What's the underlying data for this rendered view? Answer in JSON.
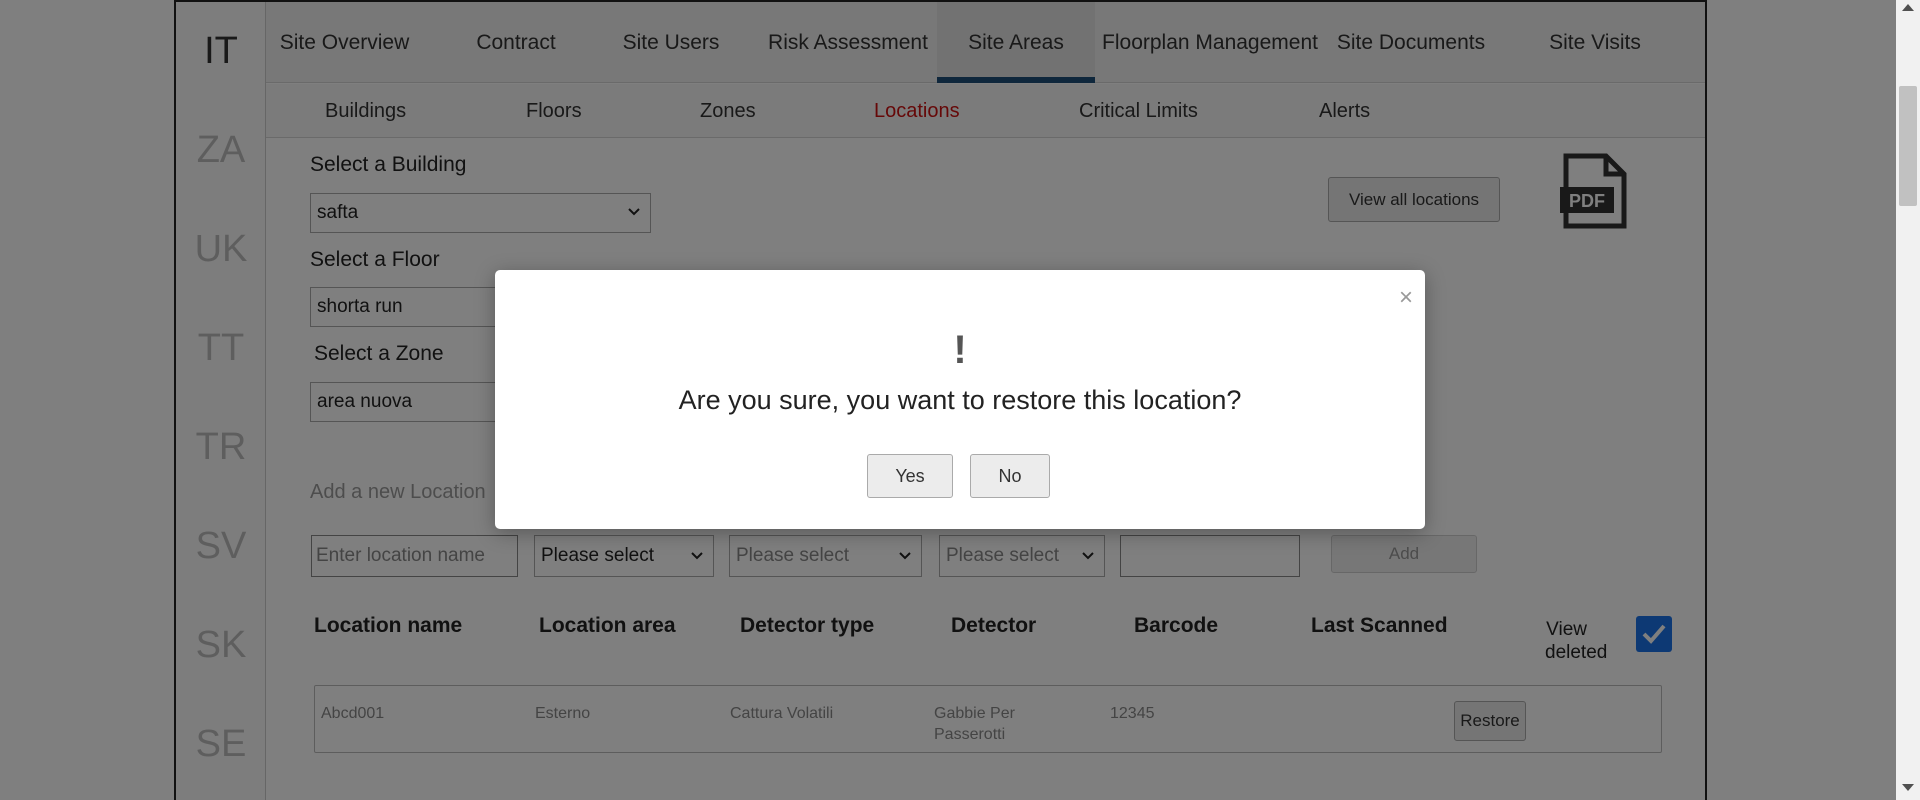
{
  "countries": [
    "IT",
    "ZA",
    "UK",
    "TT",
    "TR",
    "SV",
    "SK",
    "SE"
  ],
  "active_country": "IT",
  "top_tabs": [
    {
      "label": "Site Overview"
    },
    {
      "label": "Contract"
    },
    {
      "label": "Site Users"
    },
    {
      "label": "Risk Assessment"
    },
    {
      "label": "Site Areas"
    },
    {
      "label": "Floorplan Management"
    },
    {
      "label": "Site Documents"
    },
    {
      "label": "Site Visits"
    }
  ],
  "active_top_tab": "Site Areas",
  "sub_tabs": [
    {
      "label": "Buildings"
    },
    {
      "label": "Floors"
    },
    {
      "label": "Zones"
    },
    {
      "label": "Locations"
    },
    {
      "label": "Critical Limits"
    },
    {
      "label": "Alerts"
    }
  ],
  "active_sub_tab": "Locations",
  "selectors": {
    "building_label": "Select a Building",
    "building_value": "safta",
    "floor_label": "Select a Floor",
    "floor_value": "shorta run",
    "zone_label": "Select a Zone",
    "zone_value": "area nuova"
  },
  "view_all_label": "View all locations",
  "pdf_icon_label": "PDF",
  "add_location": {
    "title": "Add a new Location",
    "name_placeholder": "Enter location name",
    "area_select": "Please select",
    "detector_type_select": "Please select",
    "detector_select": "Please select",
    "barcode_value": "",
    "add_label": "Add"
  },
  "table": {
    "headers": [
      "Location name",
      "Location area",
      "Detector type",
      "Detector",
      "Barcode",
      "Last Scanned"
    ],
    "view_deleted_label": "View deleted",
    "view_deleted_checked": true,
    "rows": [
      {
        "name": "Abcd001",
        "area": "Esterno",
        "detector_type": "Cattura Volatili",
        "detector": "Gabbie Per Passerotti",
        "barcode": "12345",
        "last_scanned": "",
        "action": "Restore"
      }
    ]
  },
  "modal": {
    "icon": "!",
    "message": "Are you sure, you want to restore this location?",
    "yes_label": "Yes",
    "no_label": "No",
    "close_label": "×"
  },
  "colors": {
    "active_tab_underline": "#1e4e79",
    "active_subtab": "#cc1111",
    "checkbox": "#1a73e8"
  }
}
